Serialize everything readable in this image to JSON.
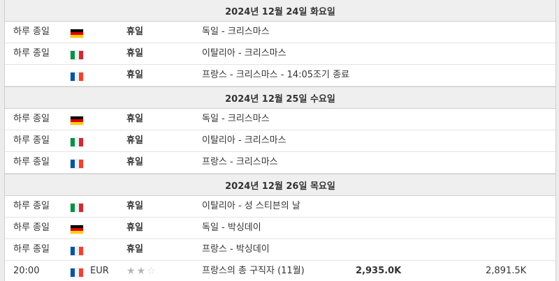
{
  "sections": [
    {
      "date": "2024년 12월 24일 화요일",
      "rows": [
        {
          "time": "하루 종일",
          "flag": "de",
          "importance": "휴일",
          "event": "독일 - 크리스마스"
        },
        {
          "time": "하루 종일",
          "flag": "it",
          "importance": "휴일",
          "event": "이탈리아 - 크리스마스"
        },
        {
          "time": "",
          "flag": "fr",
          "importance": "휴일",
          "event": "프랑스 - 크리스마스 - 14:05조기 종료"
        }
      ]
    },
    {
      "date": "2024년 12월 25일 수요일",
      "rows": [
        {
          "time": "하루 종일",
          "flag": "de",
          "importance": "휴일",
          "event": "독일 - 크리스마스"
        },
        {
          "time": "하루 종일",
          "flag": "it",
          "importance": "휴일",
          "event": "이탈리아 - 크리스마스"
        },
        {
          "time": "하루 종일",
          "flag": "fr",
          "importance": "휴일",
          "event": "프랑스 - 크리스마스"
        }
      ]
    },
    {
      "date": "2024년 12월 26일 목요일",
      "rows": [
        {
          "time": "하루 종일",
          "flag": "it",
          "importance": "휴일",
          "event": "이탈리아 - 성 스티븐의 날"
        },
        {
          "time": "하루 종일",
          "flag": "de",
          "importance": "휴일",
          "event": "독일 - 박싱데이"
        },
        {
          "time": "하루 종일",
          "flag": "fr",
          "importance": "휴일",
          "event": "프랑스 - 박싱데이"
        }
      ]
    }
  ],
  "economic_row": {
    "time": "20:00",
    "flag": "fr",
    "currency": "EUR",
    "stars_filled": 2,
    "stars_total": 3,
    "event": "프랑스의 총 구직자 (11월)",
    "actual": "2,935.0K",
    "forecast": "2,891.5K"
  },
  "icons": {
    "de": "germany-flag-icon",
    "it": "italy-flag-icon",
    "fr": "france-flag-icon",
    "star": "importance-star-icon"
  }
}
